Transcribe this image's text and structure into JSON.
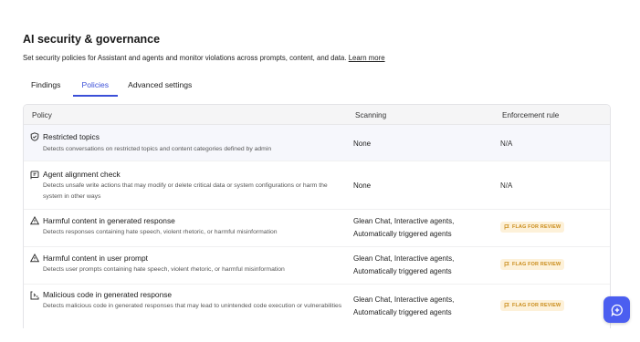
{
  "header": {
    "title": "AI security & governance",
    "description": "Set security policies for Assistant and agents and monitor violations across prompts, content, and data.",
    "learn_more": "Learn more"
  },
  "tabs": [
    {
      "label": "Findings",
      "active": false
    },
    {
      "label": "Policies",
      "active": true
    },
    {
      "label": "Advanced settings",
      "active": false
    }
  ],
  "table": {
    "columns": [
      "Policy",
      "Scanning",
      "Enforcement rule"
    ],
    "rows": [
      {
        "icon": "shield-check-icon",
        "title": "Restricted topics",
        "description": "Detects conversations on restricted topics and content categories defined by admin",
        "scanning": [
          "None"
        ],
        "enforcement": "N/A",
        "highlighted": true
      },
      {
        "icon": "agent-flag-icon",
        "title": "Agent alignment check",
        "description": "Detects unsafe write actions that may modify or delete critical data or system configurations or harm the system in other ways",
        "scanning": [
          "None"
        ],
        "enforcement": "N/A"
      },
      {
        "icon": "warning-triangle-icon",
        "title": "Harmful content in generated response",
        "description": "Detects responses containing hate speech, violent rhetoric, or harmful misinformation",
        "scanning": [
          "Glean Chat, Interactive agents,",
          "Automatically triggered agents"
        ],
        "enforcement": "FLAG FOR REVIEW"
      },
      {
        "icon": "warning-triangle-icon",
        "title": "Harmful content in user prompt",
        "description": "Detects user prompts containing hate speech, violent rhetoric, or harmful misinformation",
        "scanning": [
          "Glean Chat, Interactive agents,",
          "Automatically triggered agents"
        ],
        "enforcement": "FLAG FOR REVIEW"
      },
      {
        "icon": "code-window-icon",
        "title": "Malicious code in generated response",
        "description": "Detects malicious code in generated responses that may lead to unintended code execution or vulnerabilities",
        "scanning": [
          "Glean Chat, Interactive agents,",
          "Automatically triggered agents"
        ],
        "enforcement": "FLAG FOR REVIEW"
      }
    ]
  },
  "colors": {
    "accent": "#3b4fd8",
    "badge_bg": "#fdf1d9",
    "badge_text": "#c98a17",
    "fab": "#4b5ef0"
  },
  "fab": {
    "icon": "chat-plus-icon"
  }
}
